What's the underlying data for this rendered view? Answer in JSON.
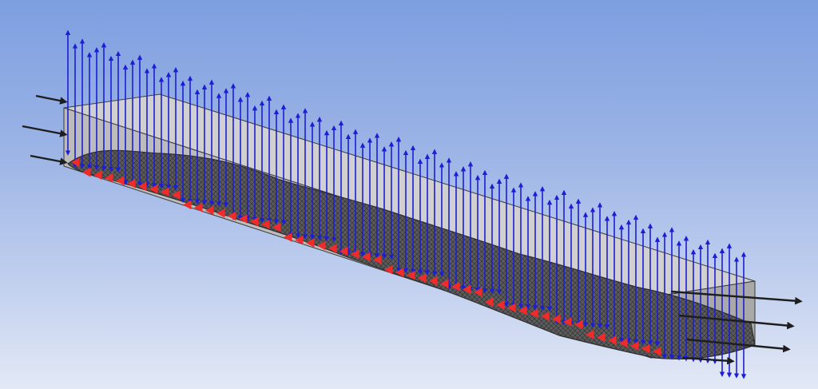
{
  "viewport": {
    "background_top": "#7d9ee0",
    "background_bottom": "#e3e9f6"
  },
  "colors": {
    "box_face": "#bdbdbd",
    "box_top": "#d0d0d0",
    "box_edge": "#3a3a3a",
    "mesh": "#2d2d2d",
    "mesh_fill": "#5b5b5b",
    "load_arrow": "#1d1dd6",
    "support": "#ef2b2b",
    "axial_arrow": "#1e1e1e"
  },
  "icons": {
    "load_arrow": "double-headed-arrow-icon",
    "support": "displacement-constraint-icon",
    "axial": "axial-force-arrow-icon"
  }
}
